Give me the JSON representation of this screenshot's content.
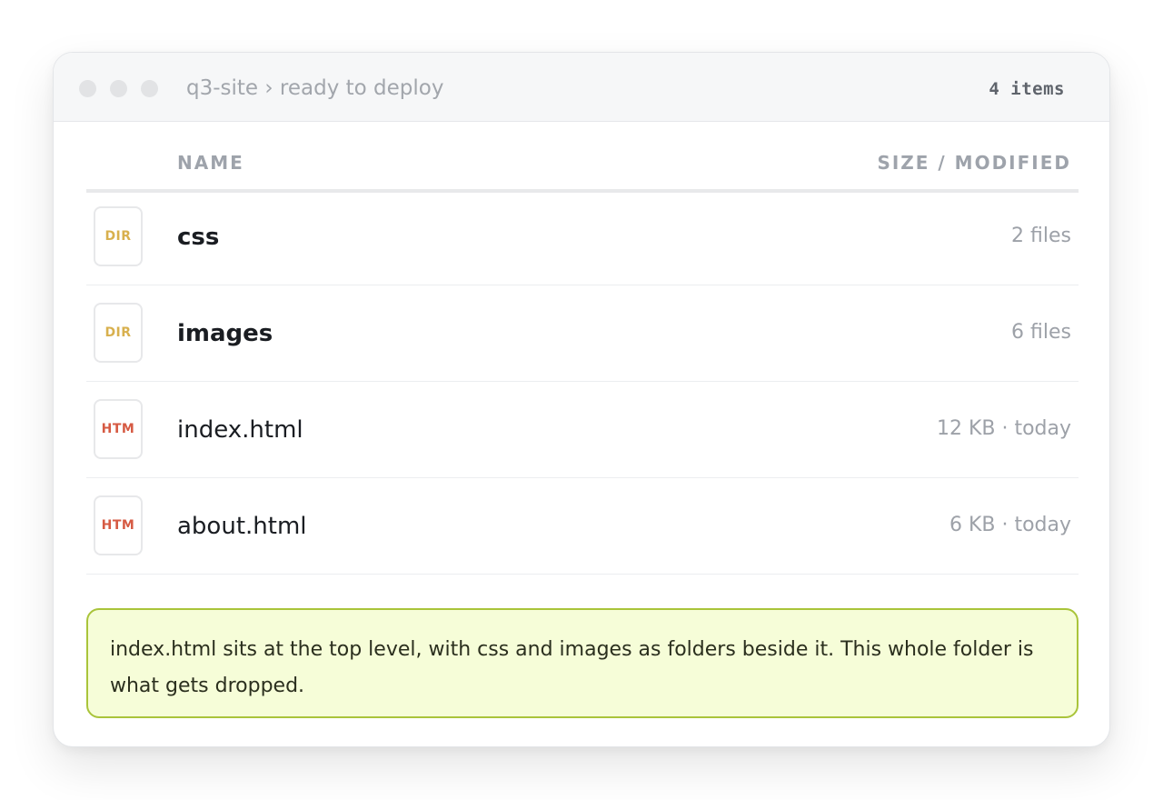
{
  "window": {
    "breadcrumb": "q3-site › ready to deploy",
    "item_count": "4 items"
  },
  "table": {
    "columns": [
      "NAME",
      "SIZE / MODIFIED"
    ],
    "rows": [
      {
        "icon": "folder-icon",
        "badge": "DIR",
        "name": "css",
        "meta": "2 files",
        "kind": "folder"
      },
      {
        "icon": "folder-icon",
        "badge": "DIR",
        "name": "images",
        "meta": "6 files",
        "kind": "folder"
      },
      {
        "icon": "html-file-icon",
        "badge": "HTM",
        "name": "index.html",
        "meta": "12 KB · today",
        "kind": "file"
      },
      {
        "icon": "html-file-icon",
        "badge": "HTM",
        "name": "about.html",
        "meta": "6 KB · today",
        "kind": "file"
      }
    ]
  },
  "note": {
    "text": "index.html sits at the top level, with css and images as folders beside it. This whole folder is what gets dropped."
  },
  "colors": {
    "dir_badge": "#d8b04e",
    "htm_badge": "#d65a43",
    "note_bg": "#f6fdd8",
    "note_border": "#a9c43a"
  }
}
